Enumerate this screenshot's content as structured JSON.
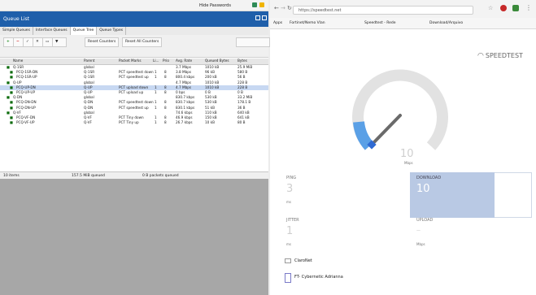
{
  "top_strip": {
    "label": "Hide Passwords"
  },
  "winbox": {
    "title": "Queue List",
    "tabs": [
      "Simple Queues",
      "Interface Queues",
      "Queue Tree",
      "Queue Types"
    ],
    "active_tab": 2,
    "toolbar": {
      "reset_counters": "Reset Counters",
      "reset_all_counters": "Reset All Counters"
    },
    "columns": [
      "Name",
      "Parent",
      "Packet Marks",
      "Li...",
      "Prio",
      "Avg. Rate",
      "Queued Bytes",
      "Bytes"
    ],
    "rows": [
      [
        "Q-1SR",
        "global",
        "",
        "",
        "",
        "3.7 Mbps",
        "1010 kB",
        "25.9 MiB"
      ],
      [
        "PCQ-1SR-DN",
        "Q-1SR",
        "PCT speedtest down",
        "1",
        "8",
        "3.8 Mbps",
        "96 kB",
        "580 B"
      ],
      [
        "PCQ-1SR-UP",
        "Q-1SR",
        "PCT speedtest up",
        "1",
        "8",
        "800.4 kbps",
        "200 kB",
        "56 B"
      ],
      [
        "Q-UP",
        "global",
        "",
        "",
        "",
        "4.7 Mbps",
        "1010 kB",
        "228 B"
      ],
      [
        "PCQ-UP-DN",
        "Q-UP",
        "PCT upload down",
        "1",
        "8",
        "4.7 Mbps",
        "1010 kB",
        "228 B"
      ],
      [
        "PCQ-UP-UP",
        "Q-UP",
        "PCT upload up",
        "1",
        "8",
        "0 bps",
        "0 B",
        "0 B"
      ],
      [
        "Q-DN",
        "global",
        "",
        "",
        "",
        "830.7 kbps",
        "530 kB",
        "33.2 MiB"
      ],
      [
        "PCQ-DN-DN",
        "Q-DN",
        "PCT speedtest down",
        "1",
        "8",
        "830.7 kbps",
        "530 kB",
        "178.1 B"
      ],
      [
        "PCQ-DN-UP",
        "Q-DN",
        "PCT speedtest up",
        "1",
        "8",
        "830.1 kbps",
        "51 kB",
        "36 B"
      ],
      [
        "Q-VF",
        "global",
        "",
        "",
        "",
        "74.6 kbps",
        "110 kB",
        "640 kB"
      ],
      [
        "PCQ-VF-DN",
        "Q-VF",
        "PCT Tiny down",
        "1",
        "8",
        "46.9 kbps",
        "150 kB",
        "641 kB"
      ],
      [
        "PCQ-VF-UP",
        "Q-VF",
        "PCT Tiny up",
        "1",
        "8",
        "26.7 kbps",
        "10 kB",
        "80 B"
      ]
    ],
    "selected_row": 4,
    "status": {
      "count": "10 items",
      "queued": "157.5 MiB queued",
      "dropped": "0 B packets queued"
    }
  },
  "browser": {
    "address": "https://speedtest.net",
    "bookmarks": [
      "Apps",
      "Fortinet/Nemo Vlan",
      "Speedtest - Rede",
      "Download/Arquivo"
    ],
    "brand": "SPEEDTEST",
    "gauge_value": "10",
    "gauge_unit": "Mbps",
    "ping_label": "PING",
    "ping_value": "3",
    "ping_unit": "ms",
    "download_label": "DOWNLOAD",
    "download_value": "10",
    "jitter_label": "JITTER",
    "jitter_value": "1",
    "jitter_unit": "ms",
    "upload_label": "UPLOAD",
    "upload_value": "—",
    "upload_unit": "Mbps",
    "provider": "ClaroNet",
    "server": "FT- Cybernetic Adrianna"
  }
}
